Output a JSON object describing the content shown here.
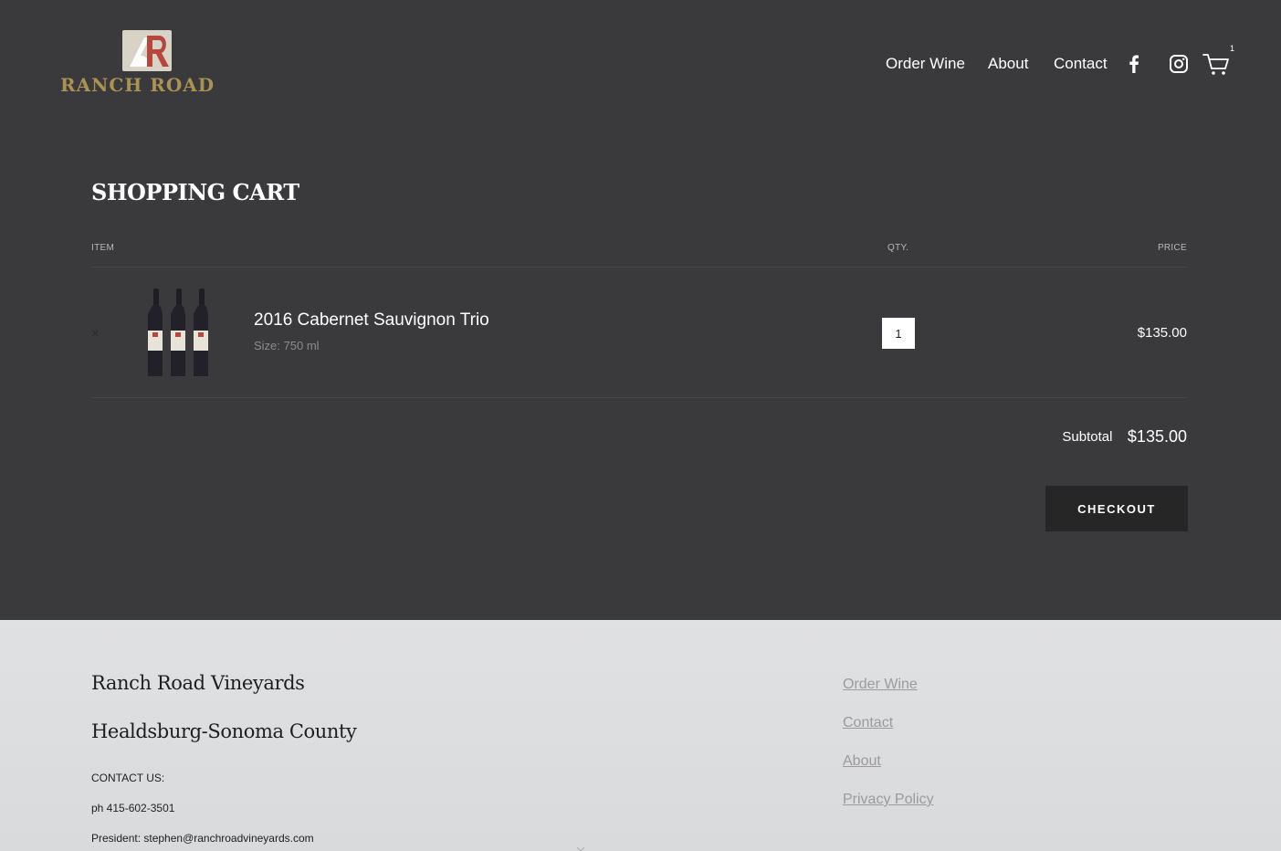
{
  "brand": {
    "logo_text": "RANCH ROAD",
    "gold_color": "#a99253",
    "mark_color": "#b5473f"
  },
  "nav": {
    "links": [
      "Order Wine",
      "About",
      "Contact"
    ],
    "icons": [
      "facebook-icon",
      "instagram-icon",
      "cart-icon"
    ],
    "cart_count": "1"
  },
  "cart": {
    "title": "SHOPPING CART",
    "columns": {
      "item": "ITEM",
      "qty": "QTY.",
      "price": "PRICE"
    },
    "items": [
      {
        "name": "2016 Cabernet Sauvignon Trio",
        "size": "Size: 750 ml",
        "quantity": "1",
        "price": "$135.00",
        "remove_symbol": "×"
      }
    ],
    "subtotal_label": "Subtotal",
    "subtotal_value": "$135.00",
    "checkout_label": "CHECKOUT"
  },
  "footer": {
    "name": "Ranch Road Vineyards",
    "location": "Healdsburg-Sonoma County",
    "contact_heading": "CONTACT US:",
    "phone": "ph 415-602-3501",
    "email": "President: stephen@ranchroadvineyards.com",
    "links": [
      "Order Wine",
      "Contact",
      "About",
      "Privacy Policy"
    ]
  },
  "colors": {
    "header_bg": "#3a3a3c",
    "footer_bg": "#e0e1e3",
    "button_bg": "#262627"
  }
}
